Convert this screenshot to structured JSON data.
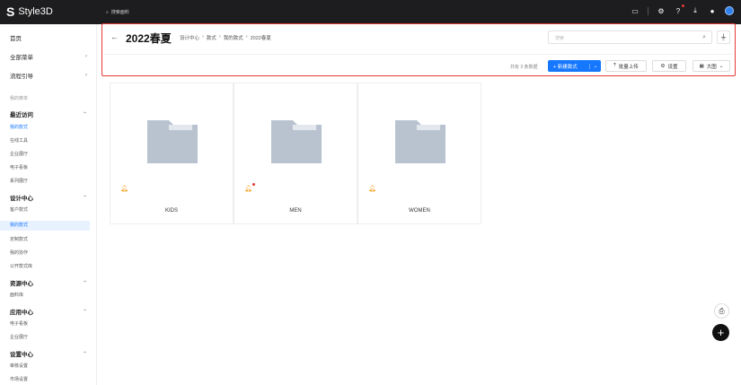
{
  "app": {
    "brand": "Style3D",
    "logo_mark": "S"
  },
  "topbar": {
    "search_placeholder": "搜索面料",
    "icons": [
      "monitor-icon",
      "gear-icon",
      "help-icon",
      "download-icon",
      "message-icon",
      "avatar"
    ]
  },
  "sidebar": {
    "home": "首页",
    "all_menu": "全部菜单",
    "flow_guide": "流程引导",
    "my_menu_label": "我的菜单",
    "sections": [
      {
        "title": "最近访问",
        "items": [
          "我的款式",
          "在线工具",
          "企业展厅",
          "电子看板",
          "系列展厅"
        ]
      },
      {
        "title": "设计中心",
        "items": [
          "客户款式",
          "我的款式",
          "定制款式",
          "我的协作",
          "公开款式库"
        ]
      },
      {
        "title": "资源中心",
        "items": [
          "面料库"
        ]
      },
      {
        "title": "应用中心",
        "items": [
          "电子看板",
          "企业展厅"
        ]
      },
      {
        "title": "设置中心",
        "items": [
          "审核设置",
          "市场设置"
        ]
      }
    ]
  },
  "header": {
    "back": "←",
    "title": "2022春夏",
    "breadcrumb": [
      "设计中心",
      "款式",
      "我的款式",
      "2022春夏"
    ],
    "search_placeholder": "搜索",
    "count_text": "共有 3 条数据",
    "new_label": "+ 新建款式",
    "upload_label": "批量上传",
    "settings_label": "设置",
    "view_label": "大图"
  },
  "cards": [
    {
      "name": "KIDS",
      "notify": false
    },
    {
      "name": "MEN",
      "notify": true
    },
    {
      "name": "WOMEN",
      "notify": false
    }
  ],
  "colors": {
    "accent": "#1677ff",
    "highlight": "#e53935",
    "folder": "#b9c3d0"
  }
}
